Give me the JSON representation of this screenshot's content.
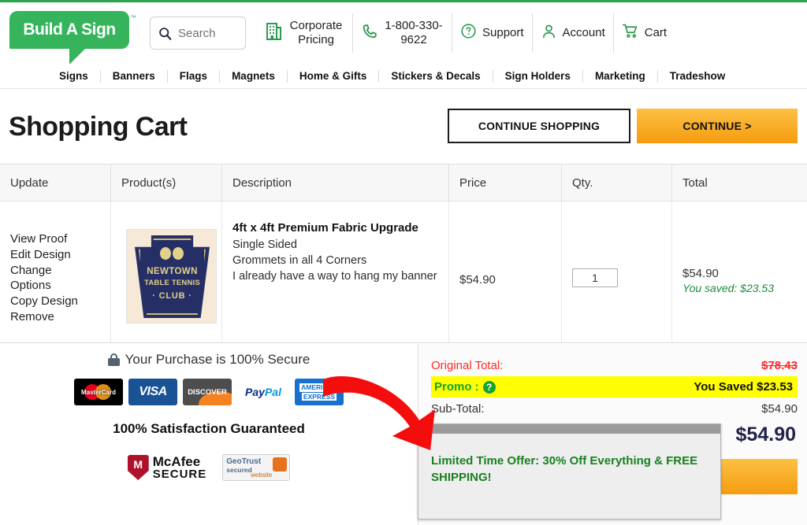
{
  "brand": {
    "logo_text": "Build A Sign",
    "tm": "™",
    "green": "#35b45c"
  },
  "header": {
    "search": {
      "placeholder": "Search",
      "icon": "search-icon"
    },
    "corporate": {
      "label": "Corporate Pricing",
      "icon": "building-icon"
    },
    "phone": {
      "label": "1-800-330-9622",
      "icon": "phone-icon"
    },
    "support": {
      "label": "Support",
      "icon": "question-circle-icon"
    },
    "account": {
      "label": "Account",
      "icon": "user-icon"
    },
    "cart": {
      "label": "Cart",
      "icon": "cart-icon"
    }
  },
  "nav": {
    "items": [
      {
        "label": "Signs"
      },
      {
        "label": "Banners"
      },
      {
        "label": "Flags"
      },
      {
        "label": "Magnets"
      },
      {
        "label": "Home & Gifts"
      },
      {
        "label": "Stickers & Decals"
      },
      {
        "label": "Sign Holders"
      },
      {
        "label": "Marketing"
      },
      {
        "label": "Tradeshow"
      }
    ]
  },
  "page": {
    "title": "Shopping Cart",
    "continue_shopping_label": "CONTINUE SHOPPING",
    "continue_label": "CONTINUE >"
  },
  "table": {
    "headers": {
      "update": "Update",
      "product": "Product(s)",
      "description": "Description",
      "price": "Price",
      "qty": "Qty.",
      "total": "Total"
    },
    "row": {
      "actions": [
        "View Proof",
        "Edit Design",
        "Change",
        "Options",
        "Copy Design",
        "Remove"
      ],
      "thumb": {
        "alt": "Newtown Table Tennis Club keystone logo",
        "line1": "NEWTOWN",
        "line2": "TABLE TENNIS",
        "line3": "· CLUB ·"
      },
      "description": {
        "title": "4ft x 4ft  Premium Fabric Upgrade",
        "lines": [
          "Single Sided",
          "Grommets in all 4 Corners",
          "I already have a way to hang my banner"
        ]
      },
      "price": "$54.90",
      "qty": "1",
      "total": "$54.90",
      "saved": "You saved: $23.53"
    }
  },
  "trust": {
    "secure_text": "Your Purchase is 100% Secure",
    "lock_icon": "lock-icon",
    "cards": [
      {
        "name": "MasterCard"
      },
      {
        "name": "VISA"
      },
      {
        "name": "DISCOVER"
      },
      {
        "name": "PayPal",
        "part1": "Pay",
        "part2": "Pal"
      },
      {
        "name": "AMERICAN EXPRESS",
        "line1": "AMERICAN",
        "line2": "EXPRESS"
      }
    ],
    "guarantee": "100% Satisfaction Guaranteed",
    "mcafee": {
      "line1": "McAfee",
      "line2": "SECURE",
      "mark": "M"
    },
    "geotrust": {
      "line1": "GeoTrust",
      "line2": "secured",
      "line3": "website"
    }
  },
  "totals": {
    "original_label": "Original Total:",
    "original_value": "$78.43",
    "promo_label": "Promo :",
    "promo_help_icon": "question-circle-icon",
    "promo_value": "You Saved $23.53",
    "subtotal_label": "Sub-Total:",
    "subtotal_value": "$54.90",
    "grand_total": "$54.90",
    "checkout_label": ""
  },
  "tooltip": {
    "text": "Limited Time Offer: 30% Off Everything & FREE SHIPPING!"
  },
  "annotation": {
    "arrow_color": "#f40d0d",
    "name": "red-arrow-annotation"
  }
}
